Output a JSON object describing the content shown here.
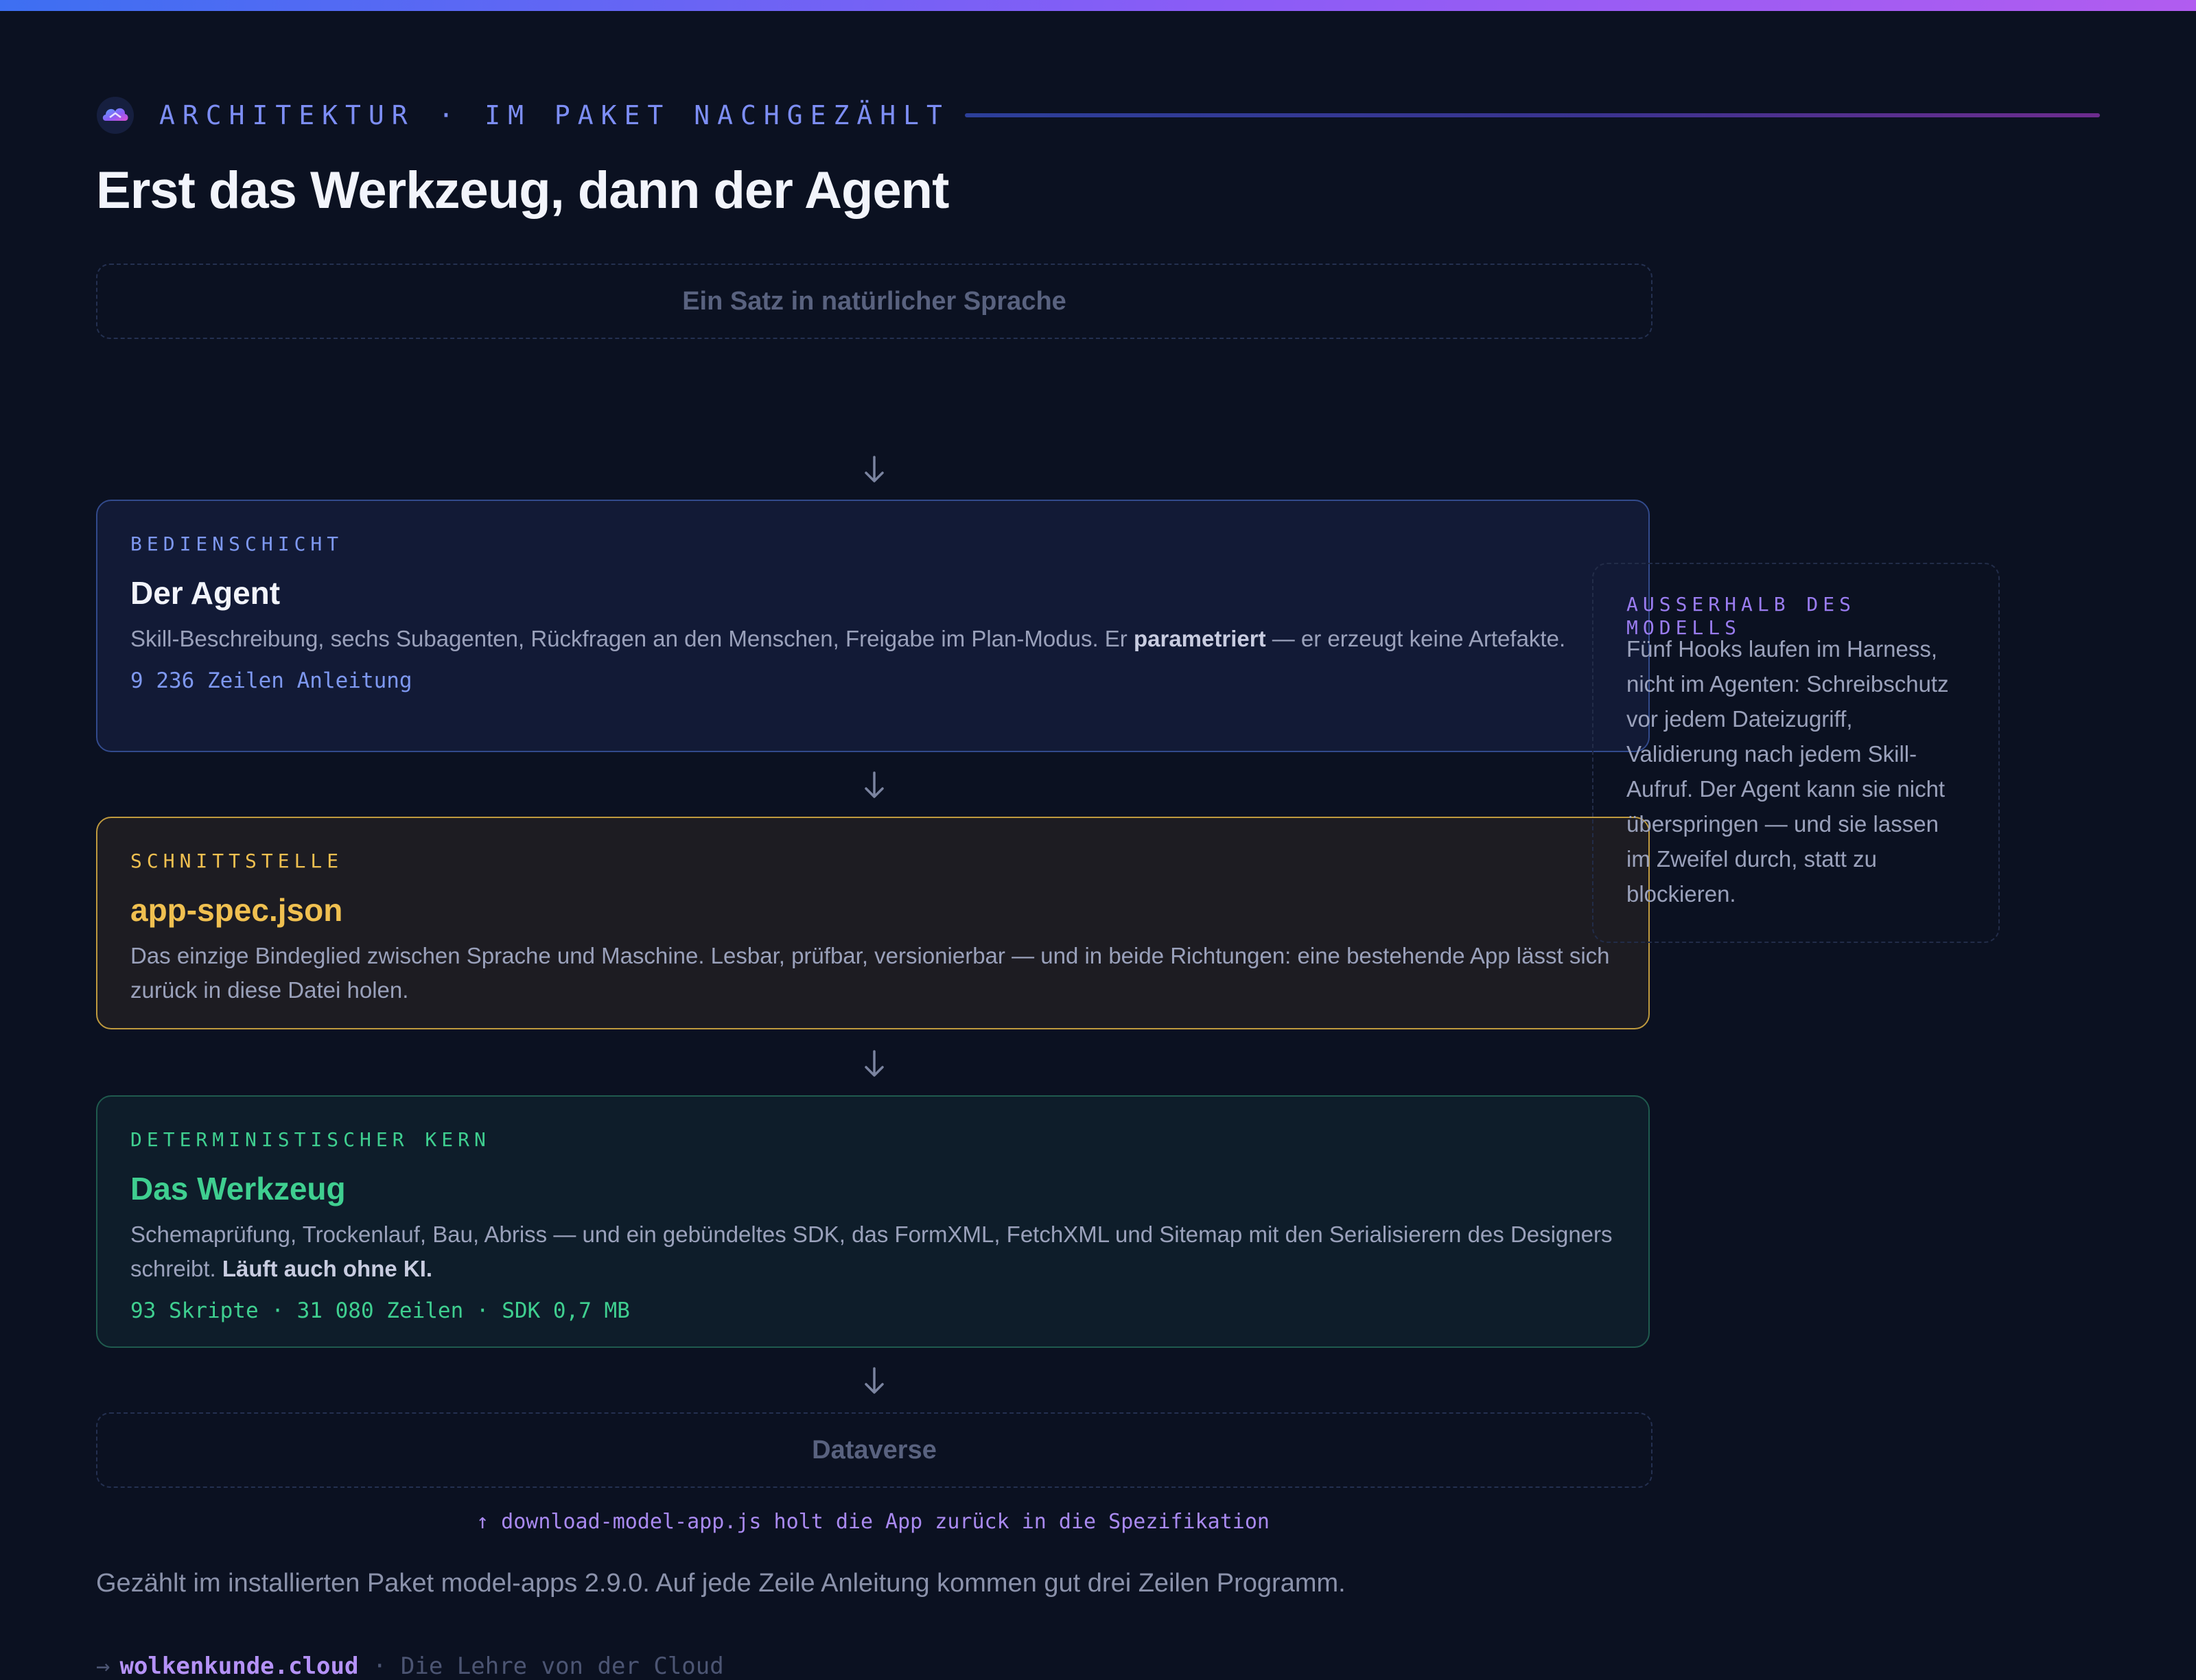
{
  "header": {
    "eyebrow": "ARCHITEKTUR · IM PAKET NACHGEZÄHLT",
    "title": "Erst das Werkzeug, dann der Agent"
  },
  "flow": {
    "input": "Ein Satz in natürlicher Sprache",
    "agent": {
      "kicker": "BEDIENSCHICHT",
      "title": "Der Agent",
      "desc_before": "Skill-Beschreibung, sechs Subagenten, Rückfragen an den Menschen, Freigabe im Plan-Modus. Er ",
      "desc_bold": "parametriert",
      "desc_after": " — er erzeugt keine Artefakte.",
      "meta": "9 236 Zeilen Anleitung"
    },
    "spec": {
      "kicker": "SCHNITTSTELLE",
      "title": "app-spec.json",
      "desc": "Das einzige Bindeglied zwischen Sprache und Maschine. Lesbar, prüfbar, versionierbar — und in beide Richtungen: eine bestehende App lässt sich zurück in diese Datei holen."
    },
    "tool": {
      "kicker": "DETERMINISTISCHER KERN",
      "title": "Das Werkzeug",
      "desc_before": "Schemaprüfung, Trockenlauf, Bau, Abriss — und ein gebündeltes SDK, das FormXML, FetchXML und Sitemap mit den Serialisierern des Designers schreibt. ",
      "desc_bold": "Läuft auch ohne KI.",
      "meta": "93 Skripte · 31 080 Zeilen · SDK 0,7 MB"
    },
    "target": "Dataverse",
    "return_note": "↑ download-model-app.js holt die App zurück in die Spezifikation"
  },
  "sidebar": {
    "kicker": "AUSSERHALB DES MODELLS",
    "text": "Fünf Hooks laufen im Harness, nicht im Agenten: Schreibschutz vor jedem Dateizugriff, Validierung nach jedem Skill-Aufruf. Der Agent kann sie nicht überspringen — und sie lassen im Zweifel durch, statt zu blockieren."
  },
  "footnote": "Gezählt im installierten Paket model-apps 2.9.0. Auf jede Zeile Anleitung kommen gut drei Zeilen Programm.",
  "footer": {
    "arrow": "→",
    "site": "wolkenkunde.cloud",
    "separator": " · ",
    "tagline": "Die Lehre von der Cloud"
  },
  "icons": {
    "logo": "cloud-logo-icon",
    "flow_arrow": "arrow-down-icon"
  },
  "colors": {
    "accent_blue": "#7e98f0",
    "accent_gold": "#f0c050",
    "accent_green": "#3fcf90",
    "accent_purple": "#a989f0",
    "background": "#0b1121"
  }
}
